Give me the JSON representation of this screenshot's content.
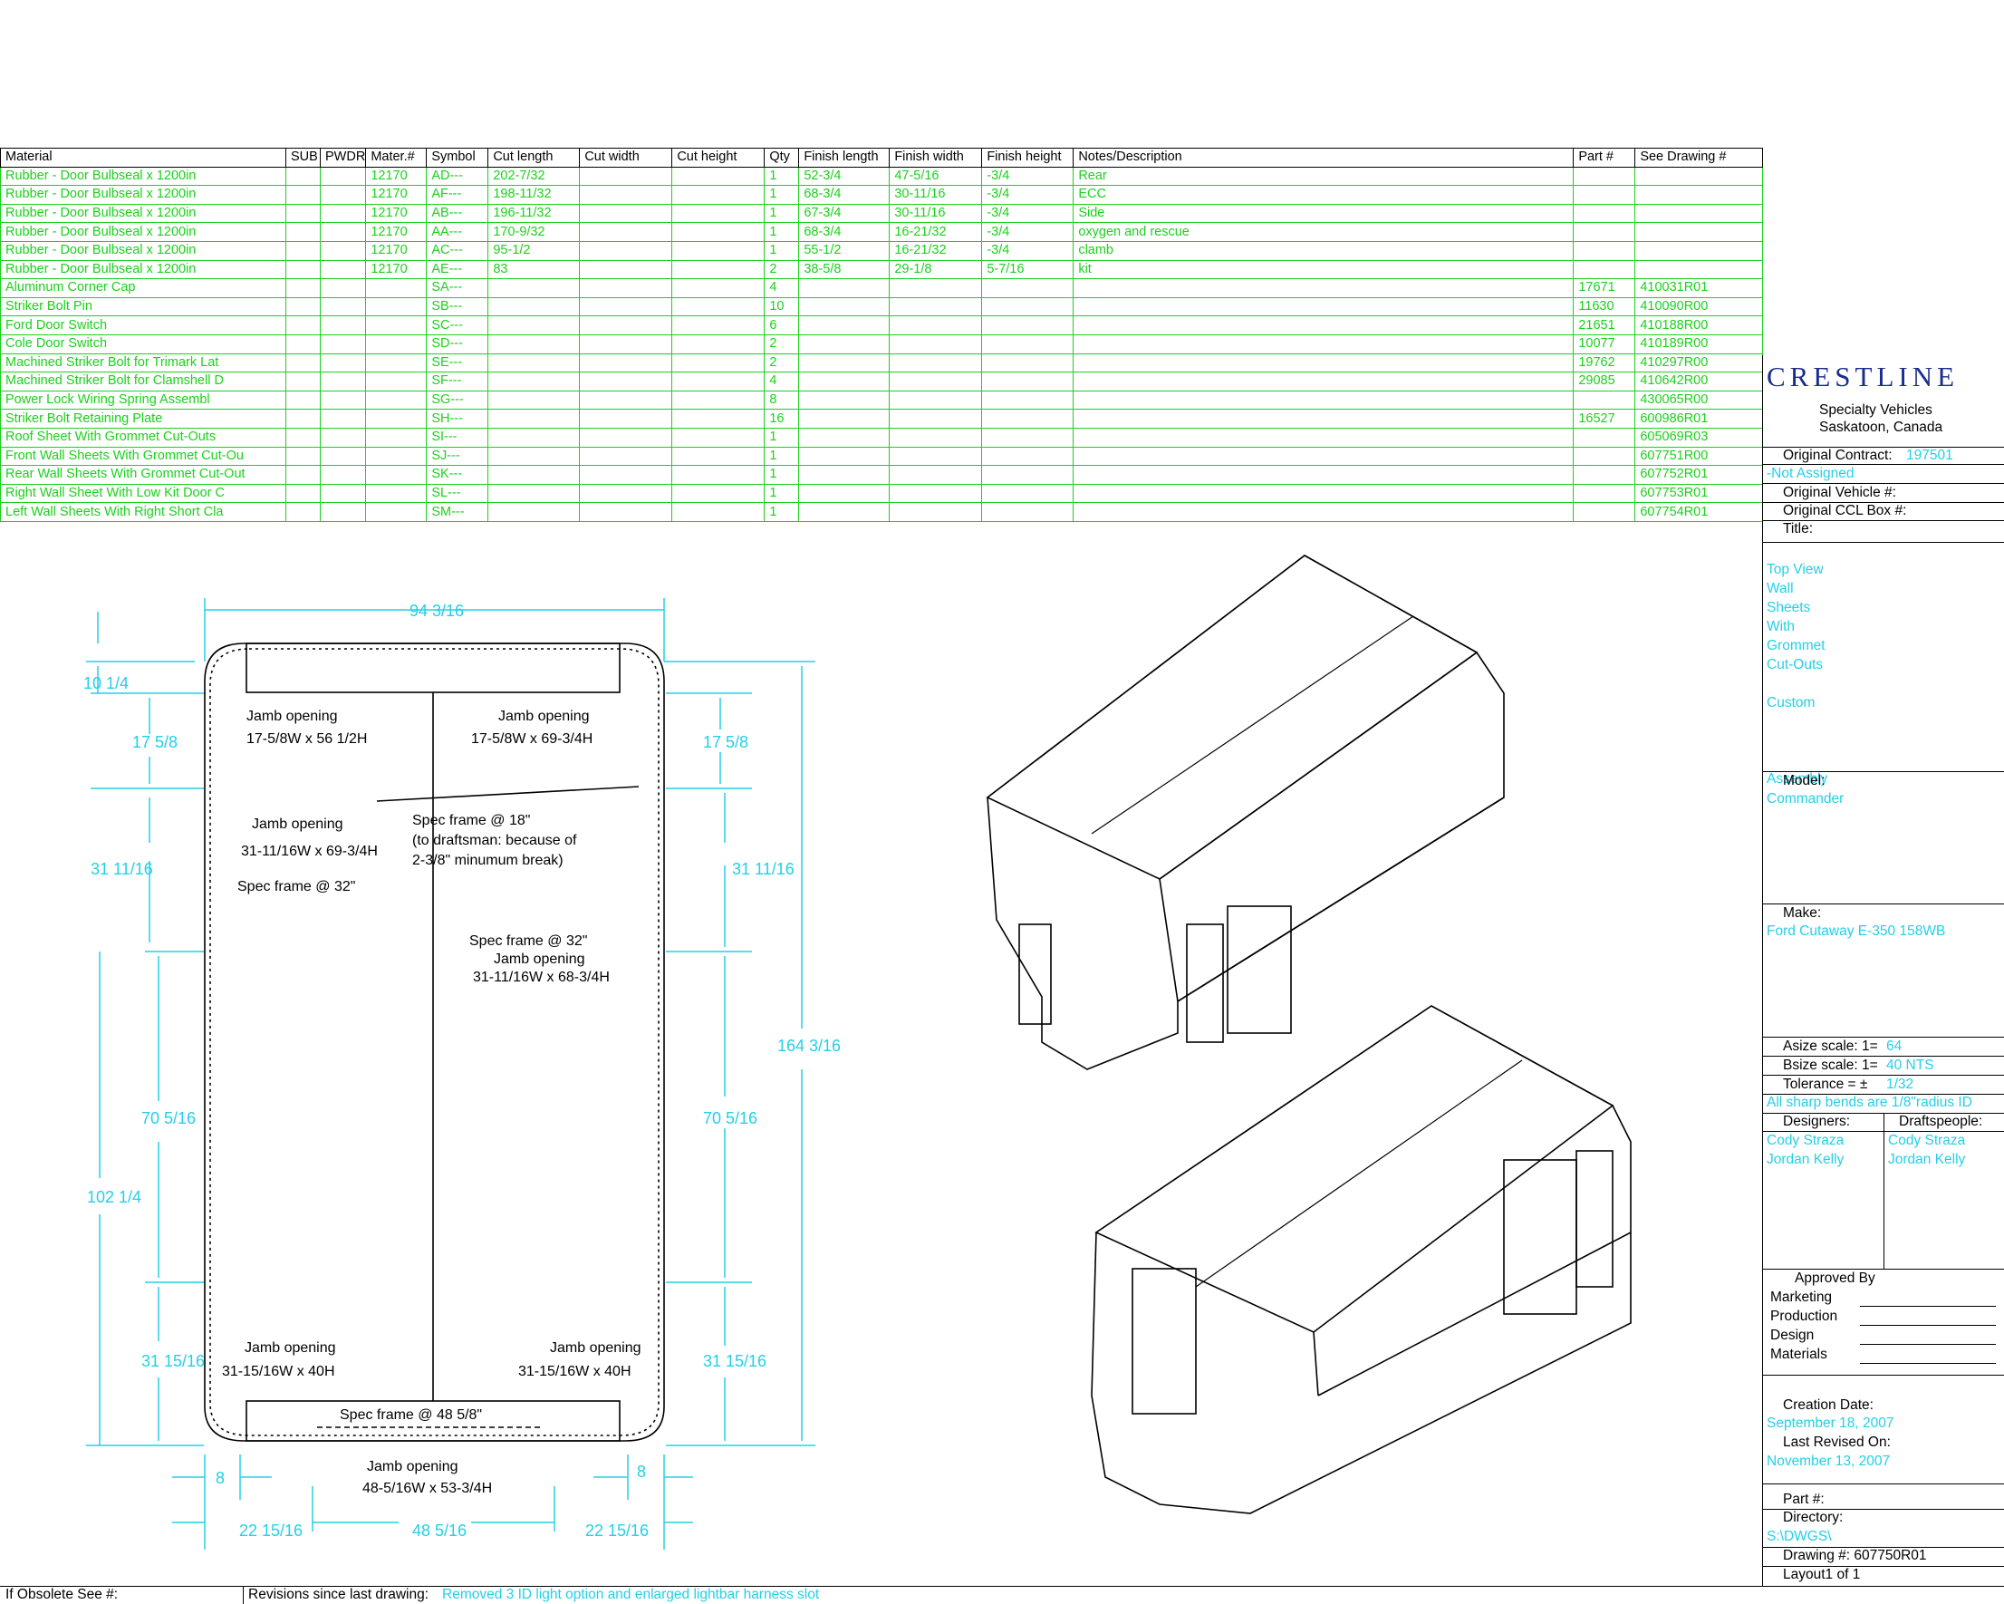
{
  "bom": {
    "headers": [
      "Material",
      "SUB",
      "PWDR",
      "Mater.#",
      "Symbol",
      "Cut length",
      "Cut width",
      "Cut height",
      "Qty",
      "Finish length",
      "Finish width",
      "Finish height",
      "Notes/Description",
      "Part #",
      "See Drawing #"
    ],
    "rows": [
      [
        "Rubber - Door Bulbseal x 1200in",
        "",
        "",
        "12170",
        "AD---",
        "202-7/32",
        "",
        "",
        "1",
        "52-3/4",
        "47-5/16",
        "-3/4",
        "Rear",
        "",
        ""
      ],
      [
        "Rubber - Door Bulbseal x 1200in",
        "",
        "",
        "12170",
        "AF---",
        "198-11/32",
        "",
        "",
        "1",
        "68-3/4",
        "30-11/16",
        "-3/4",
        "ECC",
        "",
        ""
      ],
      [
        "Rubber - Door Bulbseal x 1200in",
        "",
        "",
        "12170",
        "AB---",
        "196-11/32",
        "",
        "",
        "1",
        "67-3/4",
        "30-11/16",
        "-3/4",
        "Side",
        "",
        ""
      ],
      [
        "Rubber - Door Bulbseal x 1200in",
        "",
        "",
        "12170",
        "AA---",
        "170-9/32",
        "",
        "",
        "1",
        "68-3/4",
        "16-21/32",
        "-3/4",
        "oxygen and rescue",
        "",
        ""
      ],
      [
        "Rubber - Door Bulbseal x 1200in",
        "",
        "",
        "12170",
        "AC---",
        "95-1/2",
        "",
        "",
        "1",
        "55-1/2",
        "16-21/32",
        "-3/4",
        "clamb",
        "",
        ""
      ],
      [
        "Rubber - Door Bulbseal x 1200in",
        "",
        "",
        "12170",
        "AE---",
        "83",
        "",
        "",
        "2",
        "38-5/8",
        "29-1/8",
        "5-7/16",
        "kit",
        "",
        ""
      ],
      [
        "Aluminum Corner Cap",
        "",
        "",
        "",
        "SA---",
        "",
        "",
        "",
        "4",
        "",
        "",
        "",
        "",
        "17671",
        "410031R01"
      ],
      [
        "Striker Bolt Pin",
        "",
        "",
        "",
        "SB---",
        "",
        "",
        "",
        "10",
        "",
        "",
        "",
        "",
        "11630",
        "410090R00"
      ],
      [
        "Ford Door Switch",
        "",
        "",
        "",
        "SC---",
        "",
        "",
        "",
        "6",
        "",
        "",
        "",
        "",
        "21651",
        "410188R00"
      ],
      [
        "Cole Door Switch",
        "",
        "",
        "",
        "SD---",
        "",
        "",
        "",
        "2",
        "",
        "",
        "",
        "",
        "10077",
        "410189R00"
      ],
      [
        "Machined Striker Bolt for Trimark Lat",
        "",
        "",
        "",
        "SE---",
        "",
        "",
        "",
        "2",
        "",
        "",
        "",
        "",
        "19762",
        "410297R00"
      ],
      [
        "Machined Striker Bolt for Clamshell D",
        "",
        "",
        "",
        "SF---",
        "",
        "",
        "",
        "4",
        "",
        "",
        "",
        "",
        "29085",
        "410642R00"
      ],
      [
        "Power Lock Wiring Spring     Assembl",
        "",
        "",
        "",
        "SG---",
        "",
        "",
        "",
        "8",
        "",
        "",
        "",
        "",
        "",
        "430065R00"
      ],
      [
        "Striker Bolt Retaining Plate",
        "",
        "",
        "",
        "SH---",
        "",
        "",
        "",
        "16",
        "",
        "",
        "",
        "",
        "16527",
        "600986R01"
      ],
      [
        "Roof Sheet With Grommet Cut-Outs",
        "",
        "",
        "",
        "SI---",
        "",
        "",
        "",
        "1",
        "",
        "",
        "",
        "",
        "",
        "605069R03"
      ],
      [
        "Front Wall Sheets With Grommet Cut-Ou",
        "",
        "",
        "",
        "SJ---",
        "",
        "",
        "",
        "1",
        "",
        "",
        "",
        "",
        "",
        "607751R00"
      ],
      [
        "Rear Wall Sheets With Grommet Cut-Out",
        "",
        "",
        "",
        "SK---",
        "",
        "",
        "",
        "1",
        "",
        "",
        "",
        "",
        "",
        "607752R01"
      ],
      [
        "Right Wall Sheet With Low Kit Door  C",
        "",
        "",
        "",
        "SL---",
        "",
        "",
        "",
        "1",
        "",
        "",
        "",
        "",
        "",
        "607753R01"
      ],
      [
        "Left Wall Sheets With Right Short Cla",
        "",
        "",
        "",
        "SM---",
        "",
        "",
        "",
        "1",
        "",
        "",
        "",
        "",
        "",
        "607754R01"
      ]
    ]
  },
  "drawing": {
    "dim_top": "94 3/16",
    "dim_left_a": "10 1/4",
    "dim_left_b": "17 5/8",
    "dim_left_c": "31 11/16",
    "dim_left_d": "70 5/16",
    "dim_left_e": "102 1/4",
    "dim_left_f": "31 15/16",
    "dim_right_a": "17 5/8",
    "dim_right_b": "31 11/16",
    "dim_right_c": "70 5/16",
    "dim_right_d": "31 15/16",
    "dim_right_total": "164 3/16",
    "dim_bottom_a": "8",
    "dim_bottom_b": "8",
    "dim_bottom_c": "22 15/16",
    "dim_bottom_d": "48 5/16",
    "dim_bottom_e": "22 15/16",
    "notes": {
      "jamb1": "Jamb opening",
      "jamb1_size": "17-5/8W x 56 1/2H",
      "jamb2": "Jamb opening",
      "jamb2_size": "17-5/8W x 69-3/4H",
      "jamb3": "Jamb opening",
      "jamb3_size": "31-11/16W x 69-3/4H",
      "spec32a": "Spec frame @ 32\"",
      "spec18": "Spec frame @ 18\"",
      "spec18_note1": "(to draftsman: because of",
      "spec18_note2": "2-3/8\" minumum break)",
      "spec32b": "Spec frame @ 32\"",
      "jamb4": "Jamb opening",
      "jamb4_size": "31-11/16W x 68-3/4H",
      "jamb5": "Jamb opening",
      "jamb5_size": "31-15/16W x 40H",
      "jamb6": "Jamb opening",
      "jamb6_size": "31-15/16W x 40H",
      "spec48": "Spec frame @ 48 5/8\"",
      "jamb7": "Jamb opening",
      "jamb7_size": "48-5/16W x 53-3/4H"
    }
  },
  "titleblock": {
    "logo": "CRESTLINE",
    "company_line1": "Specialty Vehicles",
    "company_line2": "Saskatoon, Canada",
    "original_contract_label": "Original Contract:",
    "original_contract_value": "197501",
    "not_assigned": "-Not Assigned",
    "original_vehicle_label": "Original Vehicle #:",
    "original_ccl_label": "Original CCL Box #:",
    "title_label": "Title:",
    "title_lines": [
      "Top View",
      "Wall",
      "Sheets",
      "With",
      "Grommet",
      "Cut-Outs",
      "",
      "Custom",
      "",
      "",
      "",
      "Assembly"
    ],
    "model_label": "Model:",
    "model_value": "Commander",
    "make_label": "Make:",
    "make_value": "Ford Cutaway E-350 158WB",
    "asize_label": "Asize scale:  1=",
    "asize_value": "64",
    "bsize_label": "Bsize scale:  1=",
    "bsize_value": "40 NTS",
    "tolerance_label": "Tolerance = ±",
    "tolerance_value": "1/32",
    "bends_note": "All sharp bends are 1/8\"radius ID",
    "designers_label": "Designers:",
    "draftspeople_label": "Draftspeople:",
    "designers": [
      "Cody Straza",
      "Jordan Kelly"
    ],
    "draftspeople": [
      "Cody Straza",
      "Jordan Kelly"
    ],
    "approved_by_label": "Approved By",
    "approvals": [
      "Marketing",
      "Production",
      "Design",
      "Materials"
    ],
    "creation_date_label": "Creation Date:",
    "creation_date_value": "September 18, 2007",
    "last_revised_label": "Last Revised On:",
    "last_revised_value": "November 13, 2007",
    "part_label": "Part #:",
    "directory_label": "Directory:",
    "directory_value": "S:\\DWGS\\",
    "drawing_no_label": "Drawing #: 607750R01",
    "layout_label": "Layout1 of 1"
  },
  "footer": {
    "obsolete_label": "If Obsolete See #:",
    "revisions_label": "Revisions since last drawing:",
    "revisions_value": "Removed 3 ID light option and enlarged lightbar harness slot"
  }
}
